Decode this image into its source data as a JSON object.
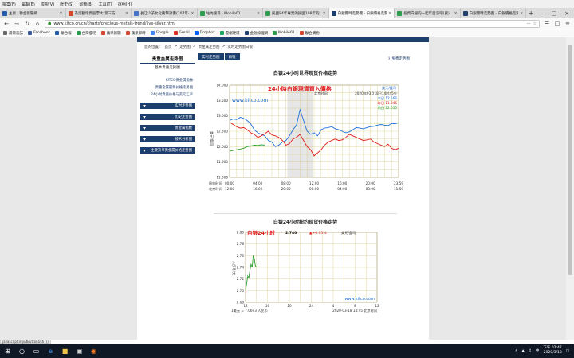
{
  "menu": [
    "檔案(F)",
    "編輯(E)",
    "檢視(V)",
    "歷史(S)",
    "書籤(B)",
    "工具(T)",
    "說明(H)"
  ],
  "tabs": [
    {
      "label": "主頁 | 聯合新聞網",
      "color": "#1e5ba8",
      "active": false
    },
    {
      "label": "為滾動增資股票大(第三方)",
      "color": "#d04a2f",
      "active": false
    },
    {
      "label": "長江少子女化衝擊計畫(107年-111年",
      "color": "#4472c4",
      "active": false
    },
    {
      "label": "站內搜尋 - Mobile01",
      "color": "#2e9e4e",
      "active": false
    },
    {
      "label": "民國84年專業的民國108年的年",
      "color": "#2e9e4e",
      "active": false
    },
    {
      "label": "白銀實時走勢圖 - 白銀價格走勢(",
      "color": "#1d3f6e",
      "active": true
    },
    {
      "label": "投資白銀的一起年后漲吧(買)",
      "color": "#2e9e4e",
      "active": false
    },
    {
      "label": "白銀實時走勢圖 - 白銀價格走勢(",
      "color": "#1d3f6e",
      "active": false
    }
  ],
  "url": "www.kitco.cn/cn/charts/precious-metals-trend/live-silver.html",
  "bookmarks": [
    {
      "label": "最常造訪",
      "color": "#6a6a6a"
    },
    {
      "label": "Facebook",
      "color": "#3b5998"
    },
    {
      "label": "聯合報",
      "color": "#1e5ba8"
    },
    {
      "label": "台灣優吧",
      "color": "#2e9e4e"
    },
    {
      "label": "蘋果新聞",
      "color": "#d04a2f"
    },
    {
      "label": "蘋果即時",
      "color": "#d04a2f"
    },
    {
      "label": "Google",
      "color": "#4285f4"
    },
    {
      "label": "Gmail",
      "color": "#d93025"
    },
    {
      "label": "Dropbox",
      "color": "#0061ff"
    },
    {
      "label": "雲端硬碟",
      "color": "#1fa463"
    },
    {
      "label": "金融線理網",
      "color": "#1d3f6e"
    },
    {
      "label": "Mobile01",
      "color": "#2e9e4e"
    },
    {
      "label": "聯合購物",
      "color": "#d04a2f"
    }
  ],
  "breadcrumbs": [
    "您的位置：",
    "首页",
    "走势图",
    "贵金属走势图",
    "实时走势图白银"
  ],
  "sidebar": {
    "heading": "贵重金属走势图",
    "sub": "基本贵重走势图",
    "links": [
      "KITCO贵金属指数",
      "贵重金属最新价格走势图",
      "24小时贵重价格与美元汇率"
    ],
    "buttons": [
      "实时走势图",
      "历史走势图",
      "贵金属指数",
      "技术分析图",
      "主要货币贵金属价格走势图"
    ]
  },
  "main": {
    "tabs": [
      "实时走势图",
      "白银"
    ],
    "more_link": "》免费走势图",
    "chart1_title": "白银24小时世界现货价格走势",
    "chart2_title": "白银24小时纽约现货价格走势"
  },
  "chart_data": [
    {
      "type": "line",
      "title": "白银24小时世界现货价格走势",
      "watermark": "www.kitco.com",
      "overlay_text": "24小時白銀現貨買入價格",
      "timezone_label": "北京时间",
      "timestamp": "2020年03月18日14时45分",
      "ylabel": "美元/盎司",
      "units_label": "美元/盎司",
      "ylim": [
        11.0,
        14.0
      ],
      "yticks": [
        "14.000",
        "13.500",
        "13.000",
        "12.500",
        "12.000",
        "11.500",
        "11.000"
      ],
      "xtick_row1_label": "纽约时间",
      "xtick_row1": [
        "00:00",
        "04:00",
        "08:00",
        "12:00",
        "16:00",
        "20:00",
        "23:59"
      ],
      "xtick_row2_label": "北京时间",
      "xtick_row2": [
        "12:00",
        "16:00",
        "20:00",
        "00:00",
        "04:00",
        "08:00",
        "11:59"
      ],
      "legend": [
        {
          "name": "今日",
          "label": "今日 12.566",
          "color": "#1e6fd9"
        },
        {
          "name": "昨日",
          "label": "昨日 11.946",
          "color": "#e01b1b"
        },
        {
          "name": "前日",
          "label": "前日 12.055",
          "color": "#2aa02a"
        }
      ],
      "series": [
        {
          "name": "今日",
          "color": "#1e6fd9",
          "x": [
            0,
            0.5,
            1,
            1.5,
            2,
            2.5,
            3,
            3.5,
            4,
            4.5,
            5,
            5.5,
            6,
            6.5,
            7,
            7.5,
            8,
            8.5,
            9,
            9.5,
            10,
            10.5,
            11,
            11.5,
            12,
            12.5,
            13,
            13.5,
            14,
            14.5,
            15,
            15.5,
            16,
            16.5,
            17,
            17.5,
            18,
            18.5,
            19,
            19.5,
            20,
            20.5,
            21,
            21.5,
            22,
            22.5,
            23,
            23.5,
            24
          ],
          "y": [
            12.85,
            12.9,
            12.88,
            12.95,
            12.92,
            12.85,
            12.74,
            12.55,
            12.45,
            12.4,
            12.35,
            12.2,
            12.15,
            12.0,
            12.05,
            12.15,
            12.2,
            12.35,
            12.55,
            12.7,
            13.2,
            12.85,
            12.5,
            12.4,
            12.45,
            12.35,
            12.55,
            12.6,
            12.62,
            12.65,
            12.58,
            12.55,
            12.5,
            12.45,
            12.48,
            12.55,
            12.62,
            12.6,
            12.58,
            12.62,
            12.65,
            12.66,
            12.7,
            12.72,
            12.7,
            12.68,
            12.75,
            12.74,
            12.78
          ]
        },
        {
          "name": "昨日",
          "color": "#e01b1b",
          "x": [
            0,
            0.5,
            1,
            1.5,
            2,
            2.5,
            3,
            3.5,
            4,
            4.5,
            5,
            5.5,
            6,
            6.5,
            7,
            7.5,
            8,
            8.5,
            9,
            9.5,
            10,
            10.5,
            11,
            11.5,
            12,
            12.5,
            13,
            13.5,
            14,
            14.5,
            15,
            15.5,
            16,
            16.5,
            17,
            17.5,
            18,
            18.5,
            19,
            19.5,
            20,
            20.5,
            21,
            21.5,
            22,
            22.5,
            23,
            23.5,
            24
          ],
          "y": [
            12.8,
            12.72,
            12.65,
            12.6,
            12.62,
            12.55,
            12.45,
            12.4,
            12.3,
            12.35,
            12.42,
            12.5,
            12.38,
            12.35,
            12.3,
            12.2,
            12.05,
            12.1,
            12.25,
            12.3,
            12.4,
            12.2,
            12.0,
            11.9,
            11.7,
            11.8,
            11.9,
            12.05,
            12.15,
            12.2,
            12.25,
            12.2,
            12.22,
            12.3,
            12.4,
            12.35,
            12.3,
            12.25,
            12.2,
            12.22,
            12.25,
            12.15,
            12.1,
            12.05,
            12.0,
            12.08,
            11.95,
            11.9,
            11.95
          ]
        },
        {
          "name": "前日",
          "color": "#2aa02a",
          "x": [
            0,
            0.5,
            1,
            1.5,
            2,
            2.5,
            3,
            3.5,
            4,
            4.5,
            5
          ],
          "y": [
            11.85,
            11.88,
            11.9,
            11.92,
            11.95,
            12.0,
            12.02,
            12.05,
            12.04,
            12.06,
            12.05
          ]
        }
      ]
    },
    {
      "type": "line",
      "title": "白银24小时纽约现货价格走势",
      "overlay_text": "白银24小时",
      "last_price": "2.740",
      "change": "+0.05%",
      "watermark": "www.kitco.com",
      "footer_left": "1美元 = 7.0693 人民币",
      "footer_right": "2020-03-18 14:45 北京时间",
      "units_label": "美元/盎司",
      "ylabel": "人民币/克",
      "ylim": [
        2.68,
        2.8
      ],
      "yticks": [
        "2.80",
        "2.78",
        "2.76",
        "2.74",
        "2.72",
        "2.70",
        "2.68"
      ],
      "xticks": [
        "12",
        "16",
        "20",
        "24",
        "4",
        "8",
        "12"
      ],
      "series": [
        {
          "name": "人民币/克",
          "color": "#2aa02a",
          "x": [
            0,
            0.2,
            0.4,
            0.6,
            0.8,
            1.0,
            1.2,
            1.4,
            1.6,
            1.8,
            2.0
          ],
          "y": [
            2.7,
            2.712,
            2.725,
            2.722,
            2.735,
            2.745,
            2.74,
            2.76,
            2.755,
            2.742,
            2.74
          ]
        }
      ]
    }
  ],
  "status_text": "javascript:inputButtonUs67()",
  "clock": {
    "time": "下午 02:47",
    "date": "2020/3/18"
  }
}
